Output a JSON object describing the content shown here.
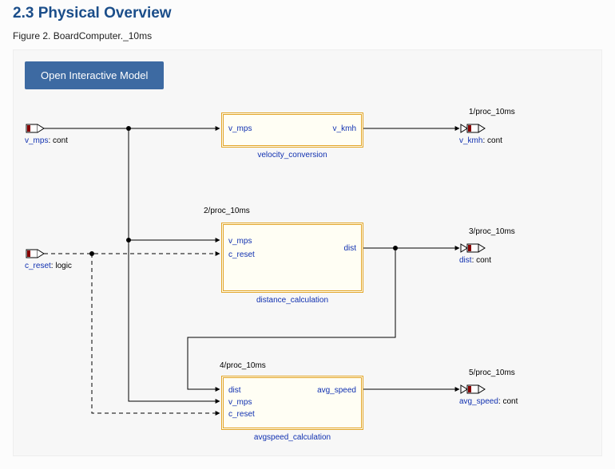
{
  "section_title": "2.3 Physical Overview",
  "figure_caption": "Figure 2. BoardComputer._10ms",
  "button_label": "Open Interactive Model",
  "inputs": {
    "v_mps": {
      "name": "v_mps",
      "type": ": cont"
    },
    "c_reset": {
      "name": "c_reset",
      "type": ": logic"
    }
  },
  "outputs": {
    "v_kmh": {
      "tag": "1/proc_10ms",
      "name": "v_kmh",
      "type": ": cont"
    },
    "dist": {
      "tag": "3/proc_10ms",
      "name": "dist",
      "type": ": cont"
    },
    "avg_speed": {
      "tag": "5/proc_10ms",
      "name": "avg_speed",
      "type": ": cont"
    }
  },
  "blocks": {
    "velocity_conversion": {
      "tag": "",
      "caption": "velocity_conversion",
      "ports": {
        "in1": "v_mps",
        "out1": "v_kmh"
      }
    },
    "distance_calculation": {
      "tag": "2/proc_10ms",
      "caption": "distance_calculation",
      "ports": {
        "in1": "v_mps",
        "in2": "c_reset",
        "out1": "dist"
      }
    },
    "avgspeed_calculation": {
      "tag": "4/proc_10ms",
      "caption": "avgspeed_calculation",
      "ports": {
        "in1": "dist",
        "in2": "v_mps",
        "in3": "c_reset",
        "out1": "avg_speed"
      }
    }
  }
}
